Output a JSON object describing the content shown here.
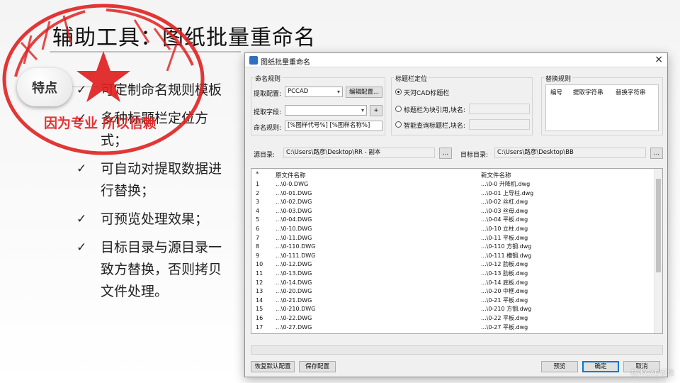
{
  "slide": {
    "title": "辅助工具：图纸批量重命名",
    "badge": "特点",
    "features": [
      "可定制命名规则模板",
      "多种标题栏定位方式；",
      "可自动对提取数据进行替换；",
      "可预览处理效果；",
      "目标目录与源目录一致方替换，否则拷贝文件处理。"
    ],
    "check_icon": "checkmark-icon",
    "seal_text": "因为专业 所以信赖",
    "seal_color": "#e02020"
  },
  "dialog": {
    "title": "图纸批量重命名",
    "close": "×",
    "naming": {
      "group_label": "命名规则",
      "config_label": "提取配置:",
      "config_value": "PCCAD",
      "edit_config": "编辑配置...",
      "field_label": "提取字段:",
      "field_value": "",
      "add": "+",
      "rule_label": "命名规则:",
      "rule_value": "[%图样代号%] [%图样名称%]"
    },
    "titlebar": {
      "group_label": "标题栏定位",
      "options": [
        "天河CAD标题栏",
        "标题栏为块引用,块名:",
        "智能查询标题栏,块名:"
      ],
      "selected": 0
    },
    "replace": {
      "group_label": "替换规则",
      "columns": [
        "编号",
        "提取字符串",
        "替换字符串"
      ]
    },
    "source_label": "源目录:",
    "source_value": "C:\\Users\\路彦\\Desktop\\RR - 副本",
    "target_label": "目标目录:",
    "target_value": "C:\\Users\\路彦\\Desktop\\BB",
    "browse": "...",
    "list": {
      "columns": [
        "*",
        "原文件名称",
        "新文件名称"
      ],
      "rows": [
        [
          "1",
          "...\\0-0.DWG",
          "...\\0-0 升降机.dwg"
        ],
        [
          "2",
          "...\\0-01.DWG",
          "...\\0-01 上导柱.dwg"
        ],
        [
          "3",
          "...\\0-02.DWG",
          "...\\0-02 丝杠.dwg"
        ],
        [
          "4",
          "...\\0-03.DWG",
          "...\\0-03 丝母.dwg"
        ],
        [
          "5",
          "...\\0-04.DWG",
          "...\\0-04 平板.dwg"
        ],
        [
          "6",
          "...\\0-10.DWG",
          "...\\0-10 立柱.dwg"
        ],
        [
          "7",
          "...\\0-11.DWG",
          "...\\0-11 平板.dwg"
        ],
        [
          "8",
          "...\\0-110.DWG",
          "...\\0-110 方钢.dwg"
        ],
        [
          "9",
          "...\\0-111.DWG",
          "...\\0-111 槽钢.dwg"
        ],
        [
          "10",
          "...\\0-12.DWG",
          "...\\0-12 肋板.dwg"
        ],
        [
          "11",
          "...\\0-13.DWG",
          "...\\0-13 肋板.dwg"
        ],
        [
          "12",
          "...\\0-14.DWG",
          "...\\0-14 底板.dwg"
        ],
        [
          "13",
          "...\\0-20.DWG",
          "...\\0-20 中框.dwg"
        ],
        [
          "14",
          "...\\0-21.DWG",
          "...\\0-21 平板.dwg"
        ],
        [
          "15",
          "...\\0-210.DWG",
          "...\\0-210 方钢.dwg"
        ],
        [
          "16",
          "...\\0-22.DWG",
          "...\\0-22 平板.dwg"
        ],
        [
          "17",
          "...\\0-27.DWG",
          "...\\0-27 平板.dwg"
        ]
      ]
    },
    "buttons": {
      "restore": "恢复默认配置",
      "save": "保存配置",
      "preview": "预览",
      "ok": "确定",
      "cancel": "取消"
    }
  },
  "watermark": "技术CAD论坛"
}
